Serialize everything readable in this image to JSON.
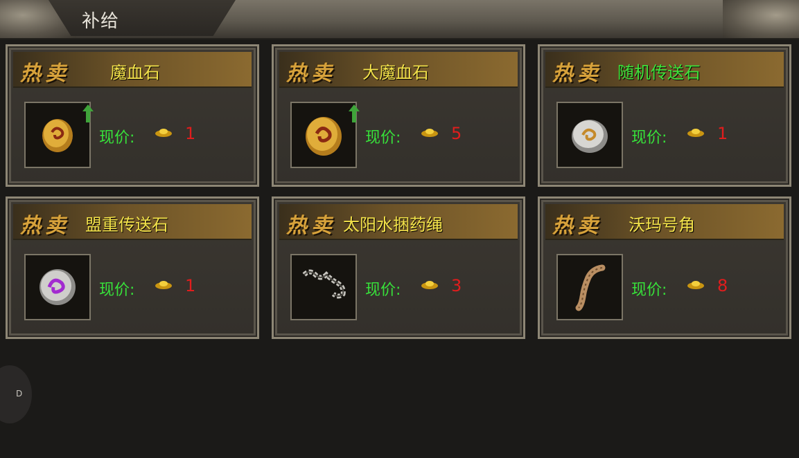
{
  "window": {
    "title": "补给"
  },
  "hot_label": "热卖",
  "price_label": "现价:",
  "items": [
    {
      "name": "魔血石",
      "price": "1",
      "name_color": "yellow",
      "icon": "blood-stone-icon",
      "upgrade": true
    },
    {
      "name": "大魔血石",
      "price": "5",
      "name_color": "yellow",
      "icon": "large-blood-stone-icon",
      "upgrade": true
    },
    {
      "name": "随机传送石",
      "price": "1",
      "name_color": "green",
      "icon": "random-teleport-stone-icon",
      "upgrade": false
    },
    {
      "name": "盟重传送石",
      "price": "1",
      "name_color": "yellow",
      "icon": "mengzhong-teleport-stone-icon",
      "upgrade": false
    },
    {
      "name": "太阳水捆药绳",
      "price": "3",
      "name_color": "yellow",
      "icon": "potion-rope-icon",
      "upgrade": false
    },
    {
      "name": "沃玛号角",
      "price": "8",
      "name_color": "yellow",
      "icon": "woma-horn-icon",
      "upgrade": false
    }
  ],
  "float_button": {
    "label": "D"
  },
  "colors": {
    "name_yellow": "#f3e24a",
    "name_green": "#3ee23a",
    "price_label": "#37e23a",
    "price_value": "#e01d1d",
    "hot_gold": "#d7a23b"
  }
}
